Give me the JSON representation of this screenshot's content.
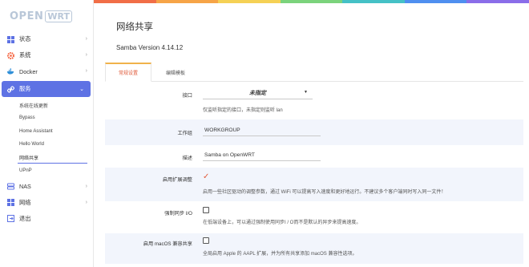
{
  "logo": {
    "open": "OPEN",
    "wrt": "WRT"
  },
  "sidebar": {
    "items": [
      {
        "label": "状态",
        "icon": "status-icon"
      },
      {
        "label": "系统",
        "icon": "system-gear-icon"
      },
      {
        "label": "Docker",
        "icon": "docker-icon"
      },
      {
        "label": "服务",
        "icon": "services-link-icon"
      }
    ],
    "sub_items": [
      "系统在线更新",
      "Bypass",
      "Home Assistant",
      "Hello World",
      "网络共享",
      "UPnP"
    ],
    "bottom_items": [
      {
        "label": "NAS",
        "icon": "nas-icon"
      },
      {
        "label": "网络",
        "icon": "network-icon"
      },
      {
        "label": "退出",
        "icon": "logout-icon"
      }
    ]
  },
  "colors": {
    "accent": "#5e72e4",
    "tab_active_text": "#e05a3a",
    "checkmark": "#e25b3c",
    "topbar": [
      "#f16e47",
      "#f6a447",
      "#f5d155",
      "#7bd37c",
      "#45c1c6",
      "#4f8ff0",
      "#8a6de9"
    ]
  },
  "page": {
    "title": "网络共享",
    "version": "Samba Version 4.14.12"
  },
  "tabs": [
    "常规设置",
    "编辑模板"
  ],
  "form": {
    "interface": {
      "label": "接口",
      "value": "未指定",
      "desc": "仅监听指定的接口，未指定则监听 lan"
    },
    "workgroup": {
      "label": "工作组",
      "value": "WORKGROUP"
    },
    "description": {
      "label": "描述",
      "value": "Samba on OpenWRT"
    },
    "extension_tuning": {
      "label": "启用扩展调整",
      "checked": true,
      "desc": "启用一些社区驱动的调整参数，通过 WiFi 可以提高写入速度和更好地运行。不建议多个客户端同时写入同一文件！"
    },
    "force_sync_io": {
      "label": "强制同步 I/O",
      "checked": false,
      "desc": "在低端设备上，可以通过强制使用同步I / O而不是默认的异步来提高速度。"
    },
    "macos_compat": {
      "label": "启用 macOS 兼容共享",
      "checked": false,
      "desc": "全局启用 Apple 的 AAPL 扩展，并为所有共享添加 macOS 兼容性选项。"
    }
  }
}
